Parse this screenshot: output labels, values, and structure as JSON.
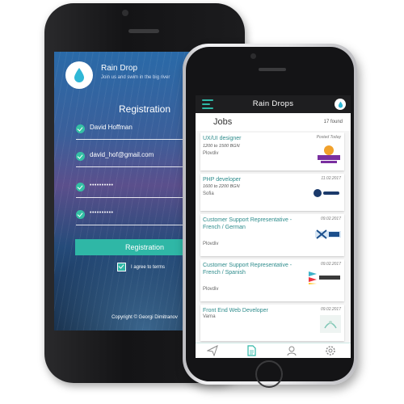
{
  "back_screen": {
    "brand_title": "Rain Drop",
    "brand_subtitle": "Join us and swim in the big river",
    "heading": "Registration",
    "fields": [
      {
        "value": "David Hoffman"
      },
      {
        "value": "david_hof@gmail.com"
      },
      {
        "value": "••••••••••"
      },
      {
        "value": "••••••••••"
      }
    ],
    "button_label": "Registration",
    "terms_label": "I agree to terms",
    "copyright": "Copyright © Georgi Dimitranov"
  },
  "front_screen": {
    "app_title": "Rain Drops",
    "jobs_title": "Jobs",
    "jobs_count": "17 found",
    "jobs": [
      {
        "title": "UX/UI designer",
        "salary": "1200 to 1500 BGN",
        "city": "Plovdiv",
        "date": "Posted Today",
        "logo": "PUPPY TOWN"
      },
      {
        "title": "PHP developer",
        "salary": "1600 to 2200 BGN",
        "city": "Sofia",
        "date": "11.02.2017",
        "logo": "Expedia"
      },
      {
        "title": "Customer Support Representative - French / German",
        "salary": "",
        "city": "Plovdiv",
        "date": "09.02.2017",
        "logo": "NEXUS"
      },
      {
        "title": "Customer Support Representative - French / Spanish",
        "salary": "",
        "city": "Plovdiv",
        "date": "09.02.2017",
        "logo": "Crossref"
      },
      {
        "title": "Front End Web Developer",
        "salary": "",
        "city": "Varna",
        "date": "09.02.2017",
        "logo": ""
      }
    ],
    "nav": [
      "send-icon",
      "document-icon",
      "user-icon",
      "settings-icon"
    ]
  },
  "colors": {
    "accent": "#2fb7a6",
    "job_title": "#2e8c8c",
    "topbar": "#1e1e20"
  }
}
